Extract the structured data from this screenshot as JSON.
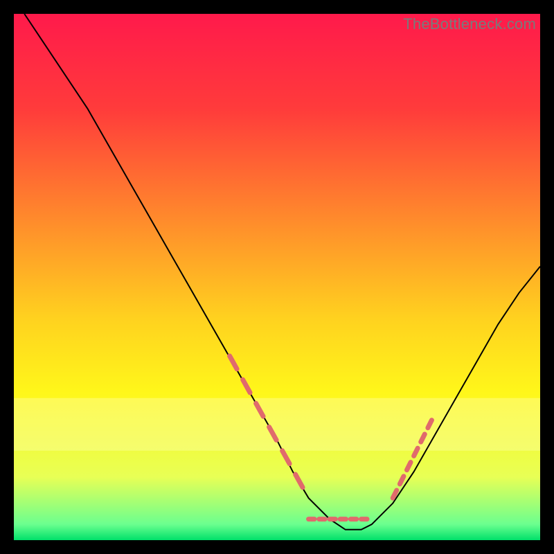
{
  "watermark": "TheBottleneck.com",
  "chart_data": {
    "type": "line",
    "title": "",
    "xlabel": "",
    "ylabel": "",
    "xlim": [
      0,
      100
    ],
    "ylim": [
      0,
      100
    ],
    "background_gradient": {
      "stops": [
        {
          "offset": 0.0,
          "color": "#ff1a4b"
        },
        {
          "offset": 0.18,
          "color": "#ff3b3b"
        },
        {
          "offset": 0.4,
          "color": "#ff8e2b"
        },
        {
          "offset": 0.58,
          "color": "#ffd21f"
        },
        {
          "offset": 0.72,
          "color": "#fff71a"
        },
        {
          "offset": 0.88,
          "color": "#e8ff55"
        },
        {
          "offset": 0.97,
          "color": "#6bff8f"
        },
        {
          "offset": 1.0,
          "color": "#00e06a"
        }
      ]
    },
    "series": [
      {
        "name": "bottleneck-curve",
        "color": "#000000",
        "stroke_width": 2,
        "x": [
          2,
          6,
          10,
          14,
          18,
          22,
          26,
          30,
          34,
          38,
          42,
          46,
          50,
          53,
          56,
          60,
          63,
          66,
          68,
          72,
          76,
          80,
          84,
          88,
          92,
          96,
          100
        ],
        "y": [
          100,
          94,
          88,
          82,
          75,
          68,
          61,
          54,
          47,
          40,
          33,
          26,
          19,
          13,
          8,
          4,
          2,
          2,
          3,
          7,
          13,
          20,
          27,
          34,
          41,
          47,
          52
        ]
      }
    ],
    "overlay_dashes": {
      "name": "highlight-dashes",
      "color": "#e06a6c",
      "stroke_width": 7,
      "sets": [
        {
          "name": "left-descent",
          "x_start": 41,
          "x_end": 56,
          "y_start": 35,
          "y_end": 8
        },
        {
          "name": "valley-floor",
          "x_start": 56,
          "x_end": 68,
          "y_start": 4,
          "y_end": 4
        },
        {
          "name": "right-ascent",
          "x_start": 72,
          "x_end": 80,
          "y_start": 8,
          "y_end": 24
        }
      ]
    },
    "highlight_band": {
      "y_start": 17,
      "y_end": 27,
      "opacity": 0.35,
      "color": "#ffffc0"
    }
  }
}
